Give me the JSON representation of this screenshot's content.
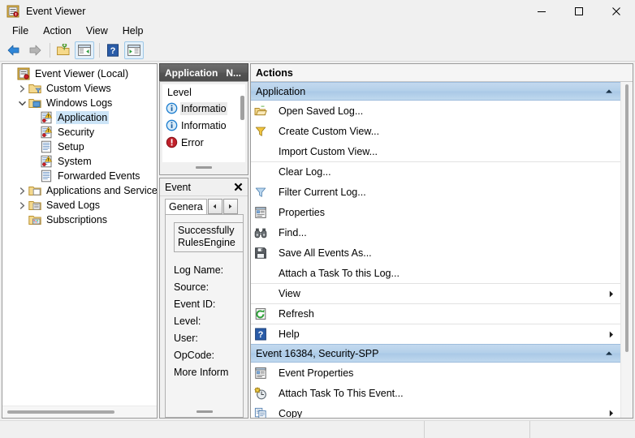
{
  "window": {
    "title": "Event Viewer",
    "app_icon": "event-viewer-icon",
    "controls": {
      "minimize": "minimize-icon",
      "maximize": "maximize-icon",
      "close": "close-icon"
    }
  },
  "menubar": {
    "items": [
      {
        "label": "File"
      },
      {
        "label": "Action"
      },
      {
        "label": "View"
      },
      {
        "label": "Help"
      }
    ]
  },
  "toolbar": {
    "buttons": [
      {
        "name": "back-button",
        "icon": "back-arrow-icon",
        "framed": false
      },
      {
        "name": "forward-button",
        "icon": "forward-arrow-icon",
        "framed": false
      },
      {
        "name": "separator-1",
        "icon": "separator",
        "framed": false
      },
      {
        "name": "open-saved-log-button",
        "icon": "folder-key-icon",
        "framed": false
      },
      {
        "name": "show-hide-console-tree-button",
        "icon": "console-tree-icon",
        "framed": true
      },
      {
        "name": "separator-2",
        "icon": "separator",
        "framed": false
      },
      {
        "name": "help-button",
        "icon": "question-mark-icon",
        "framed": false
      },
      {
        "name": "show-hide-action-pane-button",
        "icon": "action-pane-icon",
        "framed": true
      }
    ]
  },
  "tree": {
    "items": [
      {
        "label": "Event Viewer (Local)",
        "indent": 0,
        "twisty": "none",
        "icon": "event-viewer-root-icon",
        "selected": false
      },
      {
        "label": "Custom Views",
        "indent": 1,
        "twisty": "collapsed",
        "icon": "custom-views-folder-icon",
        "selected": false
      },
      {
        "label": "Windows Logs",
        "indent": 1,
        "twisty": "expanded",
        "icon": "windows-logs-folder-icon",
        "selected": false
      },
      {
        "label": "Application",
        "indent": 2,
        "twisty": "none",
        "icon": "log-warning-icon",
        "selected": true
      },
      {
        "label": "Security",
        "indent": 2,
        "twisty": "none",
        "icon": "log-warning-icon",
        "selected": false
      },
      {
        "label": "Setup",
        "indent": 2,
        "twisty": "none",
        "icon": "log-plain-icon",
        "selected": false
      },
      {
        "label": "System",
        "indent": 2,
        "twisty": "none",
        "icon": "log-warning-icon",
        "selected": false
      },
      {
        "label": "Forwarded Events",
        "indent": 2,
        "twisty": "none",
        "icon": "log-plain-icon",
        "selected": false
      },
      {
        "label": "Applications and Services Lo",
        "indent": 1,
        "twisty": "collapsed",
        "icon": "apps-services-folder-icon",
        "selected": false
      },
      {
        "label": "Saved Logs",
        "indent": 1,
        "twisty": "collapsed",
        "icon": "saved-logs-folder-icon",
        "selected": false
      },
      {
        "label": "Subscriptions",
        "indent": 1,
        "twisty": "none",
        "icon": "subscriptions-icon",
        "selected": false
      }
    ]
  },
  "middle": {
    "header": {
      "column1": "Application",
      "column2": "N..."
    },
    "level_column_header": "Level",
    "events": [
      {
        "level": "Informatio",
        "icon": "information-icon",
        "selected": true
      },
      {
        "level": "Informatio",
        "icon": "information-icon",
        "selected": false
      },
      {
        "level": "Error",
        "icon": "error-icon",
        "selected": false
      }
    ],
    "event_panel": {
      "title": "Event",
      "close_icon": "close-icon",
      "tabs": [
        {
          "label": "Genera"
        }
      ],
      "spinner_prev": "left-arrow-icon",
      "spinner_next": "right-arrow-icon",
      "message_lines": [
        "Successfully",
        "RulesEngine"
      ],
      "fields": [
        {
          "label": "Log Name:"
        },
        {
          "label": "Source:"
        },
        {
          "label": "Event ID:"
        },
        {
          "label": "Level:"
        },
        {
          "label": "User:"
        },
        {
          "label": "OpCode:"
        },
        {
          "label": "More Inform"
        }
      ]
    }
  },
  "actions": {
    "header": "Actions",
    "groups": [
      {
        "title": "Application",
        "chevron": "chevron-up-icon",
        "items": [
          {
            "label": "Open Saved Log...",
            "icon": "open-folder-icon",
            "arrow": false,
            "sep": false
          },
          {
            "label": "Create Custom View...",
            "icon": "yellow-filter-icon",
            "arrow": false,
            "sep": false
          },
          {
            "label": "Import Custom View...",
            "icon": "none",
            "arrow": false,
            "sep": false
          },
          {
            "label": "Clear Log...",
            "icon": "none",
            "arrow": false,
            "sep": true
          },
          {
            "label": "Filter Current Log...",
            "icon": "blue-filter-icon",
            "arrow": false,
            "sep": false
          },
          {
            "label": "Properties",
            "icon": "properties-icon",
            "arrow": false,
            "sep": false
          },
          {
            "label": "Find...",
            "icon": "binoculars-icon",
            "arrow": false,
            "sep": false
          },
          {
            "label": "Save All Events As...",
            "icon": "save-icon",
            "arrow": false,
            "sep": false
          },
          {
            "label": "Attach a Task To this Log...",
            "icon": "none",
            "arrow": false,
            "sep": false
          },
          {
            "label": "View",
            "icon": "none",
            "arrow": true,
            "sep": true
          },
          {
            "label": "Refresh",
            "icon": "refresh-icon",
            "arrow": false,
            "sep": true
          },
          {
            "label": "Help",
            "icon": "help-icon",
            "arrow": true,
            "sep": true
          }
        ]
      },
      {
        "title": "Event 16384, Security-SPP",
        "chevron": "chevron-up-icon",
        "items": [
          {
            "label": "Event Properties",
            "icon": "properties-icon",
            "arrow": false,
            "sep": false
          },
          {
            "label": "Attach Task To This Event...",
            "icon": "attach-task-icon",
            "arrow": false,
            "sep": false
          },
          {
            "label": "Copy",
            "icon": "copy-icon",
            "arrow": true,
            "sep": false
          }
        ]
      }
    ]
  },
  "statusbar": {
    "segments": [
      "",
      "",
      ""
    ]
  },
  "colors": {
    "window_bg": "#f0f0f0",
    "pane_border": "#9a9a9a",
    "group_header_blue": "#b3cfe9",
    "selection_blue": "#cce4f7",
    "header_dark": "#5d5d5d",
    "error_red": "#c0202a",
    "info_blue": "#1f7fd0"
  }
}
